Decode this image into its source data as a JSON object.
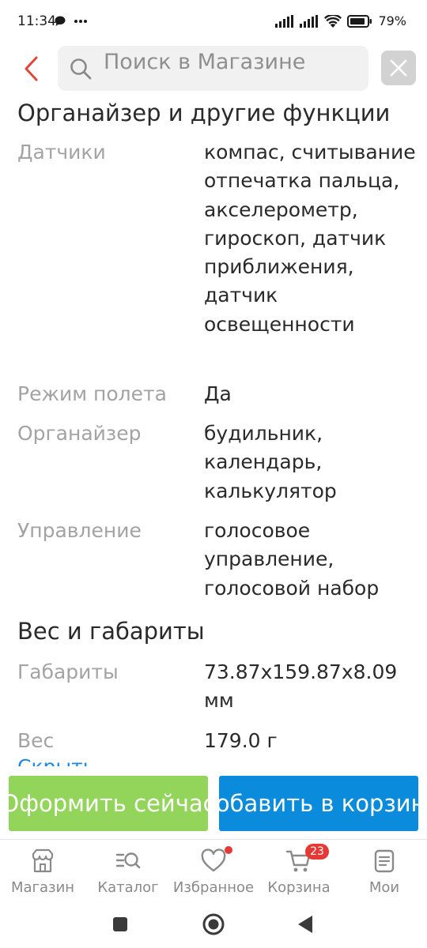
{
  "status_bar": {
    "time": "11:34",
    "battery": "79%"
  },
  "search": {
    "placeholder": "Поиск в Магазине"
  },
  "specs": {
    "organizer_section": {
      "title": "Органайзер и другие функции",
      "rows": [
        {
          "label": "Датчики",
          "value": "компас, считывание отпечатка пальца, акселерометр, гироскоп, датчик приближения, датчик освещенности"
        },
        {
          "label": "Режим полета",
          "value": "Да"
        },
        {
          "label": "Органайзер",
          "value": "будильник, календарь, калькулятор"
        },
        {
          "label": "Управление",
          "value": "голосовое управление, голосовой набор"
        }
      ]
    },
    "size_section": {
      "title": "Вес и габариты",
      "rows": [
        {
          "label": "Габариты",
          "value": "73.87x159.87x8.09 мм"
        },
        {
          "label": "Вес",
          "value": "179.0 г"
        }
      ]
    },
    "hide_link": "Скрыть"
  },
  "actions": {
    "buy_now": "Оформить сейчас",
    "add_to_cart": "Добавить в корзину"
  },
  "bottom_nav": {
    "items": [
      {
        "label": "Магазин"
      },
      {
        "label": "Каталог"
      },
      {
        "label": "Избранное"
      },
      {
        "label": "Корзина",
        "badge": "23"
      },
      {
        "label": "Мои"
      }
    ]
  },
  "colors": {
    "accent_red": "#e53935",
    "buy_green": "#93d55a",
    "cart_blue": "#0b8bdb",
    "link_blue": "#1e88e5"
  },
  "icons": {
    "back": "chevron-left-icon",
    "search": "search-icon",
    "clear": "close-icon",
    "nav": [
      "store-icon",
      "catalog-icon",
      "heart-icon",
      "cart-icon",
      "profile-list-icon"
    ],
    "system": [
      "square-recents-icon",
      "circle-home-icon",
      "triangle-back-icon"
    ]
  }
}
